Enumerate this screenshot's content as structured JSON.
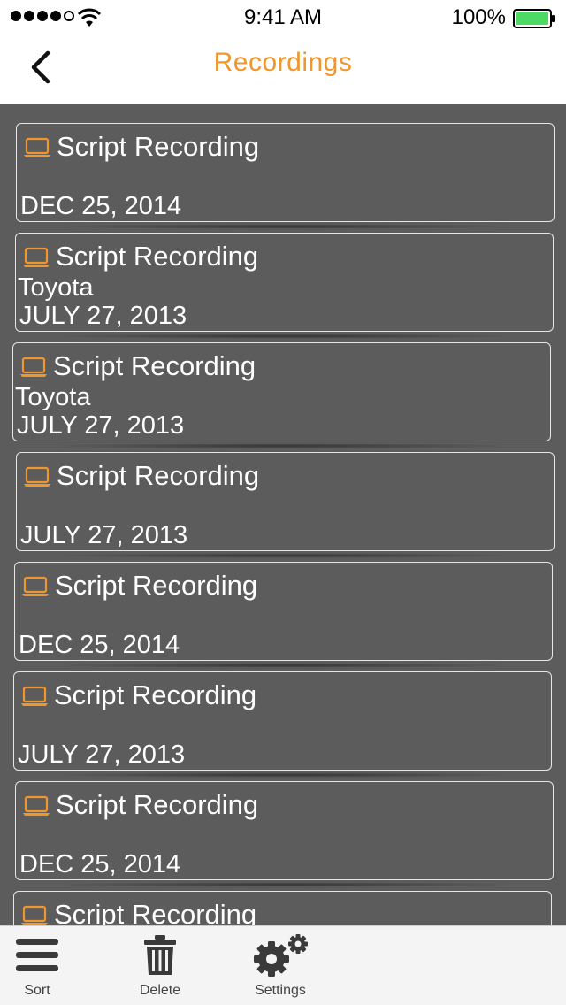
{
  "status_bar": {
    "time": "9:41 AM",
    "battery_percent": "100%",
    "battery_color": "#4cd964"
  },
  "nav": {
    "title": "Recordings",
    "title_color": "#f0962d",
    "back_icon": "chevron-left-icon"
  },
  "recordings": [
    {
      "title": "Script Recording",
      "subtitle": "",
      "date": "DEC 25, 2014"
    },
    {
      "title": "Script Recording",
      "subtitle": "Toyota",
      "date": "JULY 27, 2013"
    },
    {
      "title": "Script Recording",
      "subtitle": "Toyota",
      "date": "JULY 27, 2013"
    },
    {
      "title": "Script Recording",
      "subtitle": "",
      "date": "JULY 27, 2013"
    },
    {
      "title": "Script Recording",
      "subtitle": "",
      "date": "DEC 25, 2014"
    },
    {
      "title": "Script Recording",
      "subtitle": "",
      "date": "JULY 27, 2013"
    },
    {
      "title": "Script Recording",
      "subtitle": "",
      "date": "DEC 25, 2014"
    },
    {
      "title": "Script Recording",
      "subtitle": "",
      "date": ""
    }
  ],
  "item_icon": "laptop-icon",
  "accent_color": "#f0962d",
  "list_background": "#5c5c5c",
  "tab_bar": {
    "tabs": [
      {
        "label": "Sort",
        "icon": "hamburger-menu-icon"
      },
      {
        "label": "Delete",
        "icon": "trash-icon"
      },
      {
        "label": "Settings",
        "icon": "gears-icon"
      }
    ]
  }
}
